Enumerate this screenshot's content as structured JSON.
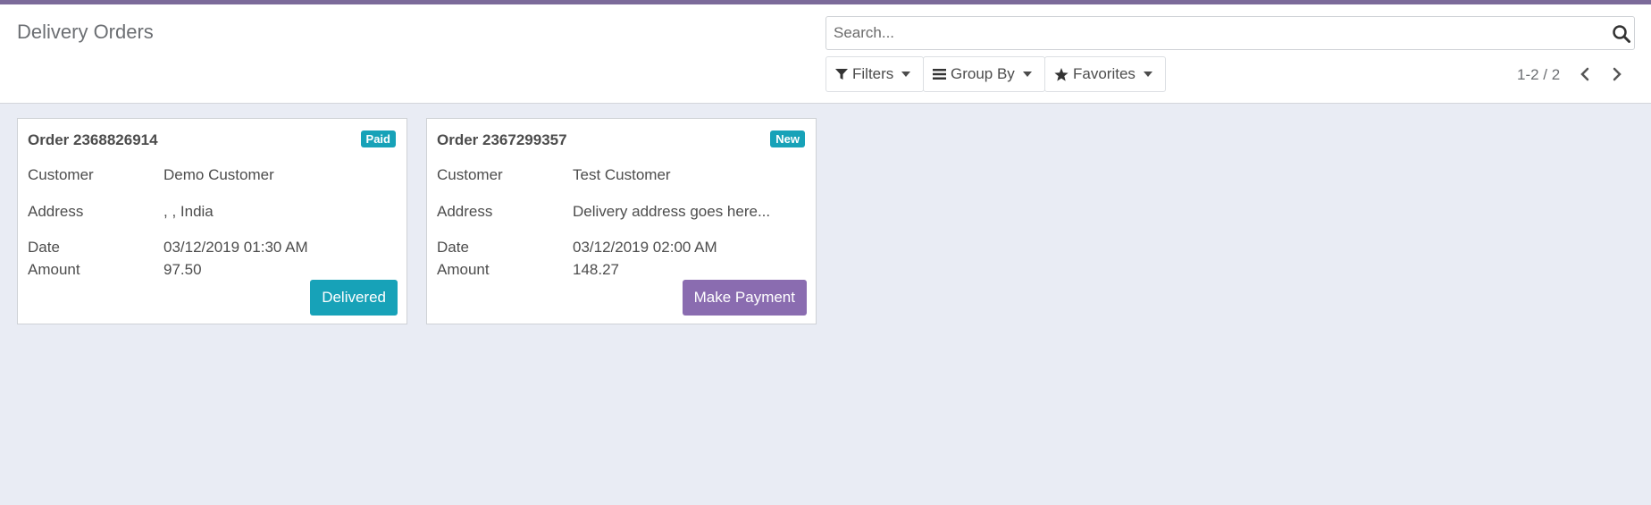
{
  "colors": {
    "topbar": "#7c6b9a",
    "badge": "#17a2b8",
    "delivered_button": "#17a2b8",
    "payment_button": "#8a6cb0",
    "background": "#e9ecf4"
  },
  "page": {
    "title": "Delivery Orders"
  },
  "search": {
    "placeholder": "Search...",
    "icon": "search-icon"
  },
  "filters": {
    "filters_label": "Filters",
    "group_by_label": "Group By",
    "favorites_label": "Favorites"
  },
  "pager": {
    "value": "1-2 / 2"
  },
  "cards": [
    {
      "title": "Order 2368826914",
      "badge": "Paid",
      "customer_label": "Customer",
      "customer": "Demo Customer",
      "address_label": "Address",
      "address": ", , India",
      "date_label": "Date",
      "date": "03/12/2019 01:30 AM",
      "amount_label": "Amount",
      "amount": "97.50",
      "action": "Delivered"
    },
    {
      "title": "Order 2367299357",
      "badge": "New",
      "customer_label": "Customer",
      "customer": "Test Customer",
      "address_label": "Address",
      "address": "Delivery address goes here...",
      "date_label": "Date",
      "date": "03/12/2019 02:00 AM",
      "amount_label": "Amount",
      "amount": "148.27",
      "action": "Make Payment"
    }
  ]
}
